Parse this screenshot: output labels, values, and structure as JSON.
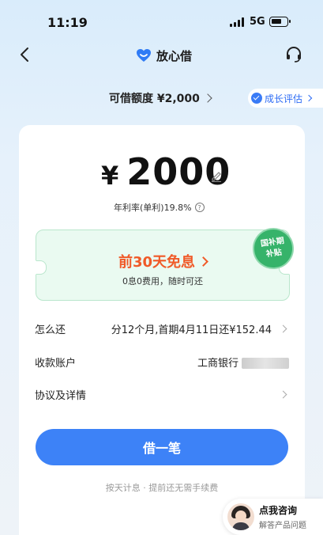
{
  "status_bar": {
    "time": "11:19",
    "network": "5G"
  },
  "nav": {
    "brand_name": "放心借",
    "icons": {
      "back": "back-arrow-icon",
      "support": "headset-icon"
    }
  },
  "quota": {
    "label": "可借额度 ¥2,000"
  },
  "growth": {
    "label": "成长评估"
  },
  "loan": {
    "currency": "¥",
    "amount": "2000",
    "rate_text": "年利率(单利)19.8%"
  },
  "promo": {
    "title": "前30天免息",
    "subtitle": "0息0费用，随时可还",
    "badge_line1": "国补期",
    "badge_line2": "补贴"
  },
  "details": {
    "repay_label": "怎么还",
    "repay_value": "分12个月,首期4月11日还¥152.44",
    "account_label": "收款账户",
    "account_value": "工商银行",
    "agreement_label": "协议及详情"
  },
  "cta": {
    "label": "借一笔"
  },
  "note": "按天计息 · 提前还无需手续费",
  "consult": {
    "title": "点我咨询",
    "subtitle": "解答产品问题"
  },
  "colors": {
    "accent": "#3d82f7",
    "promo": "#f05a28",
    "badge": "#36b36a"
  }
}
